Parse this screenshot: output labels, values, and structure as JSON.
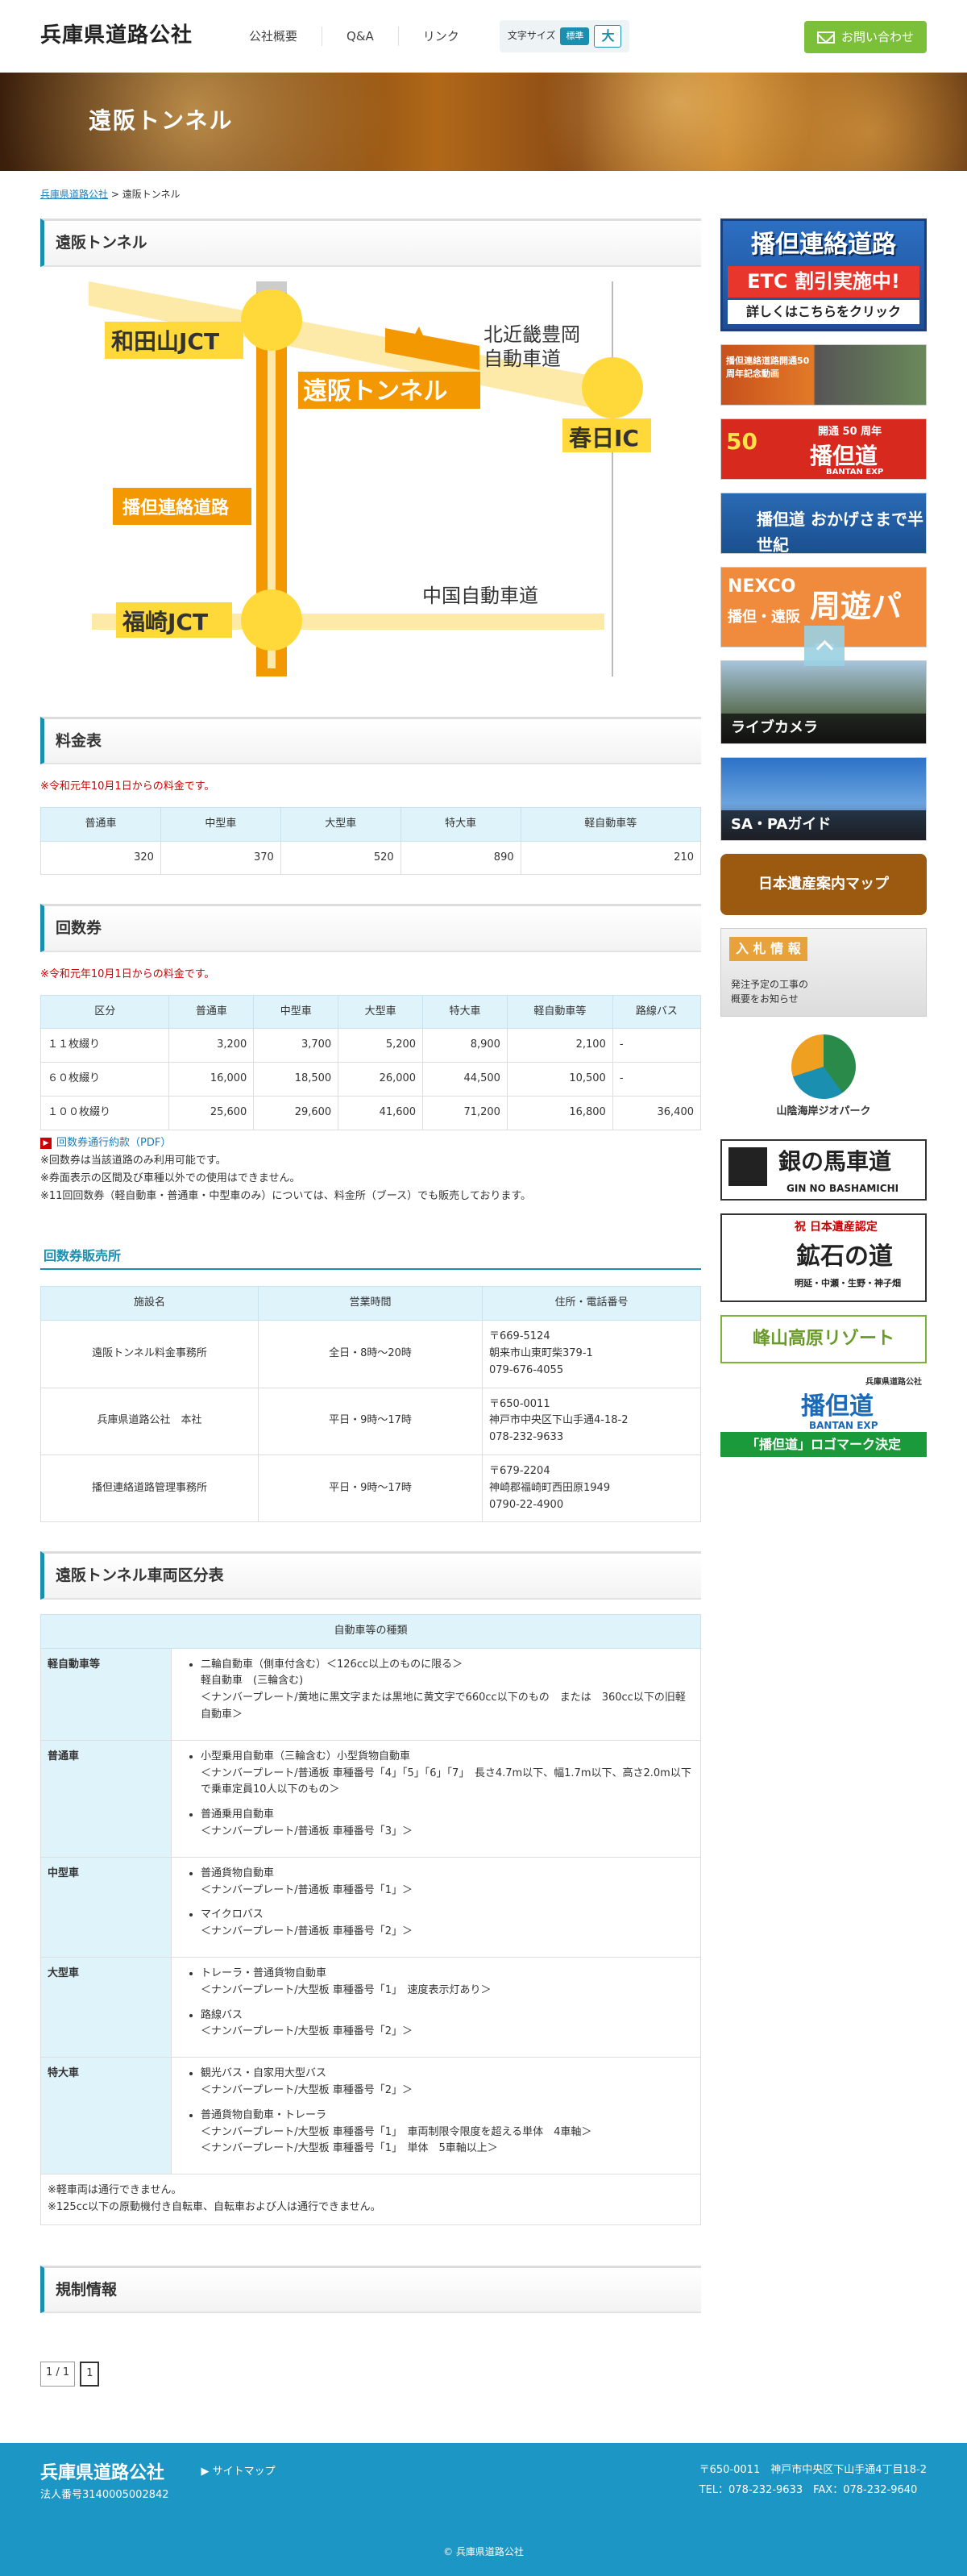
{
  "header": {
    "logo": "兵庫県道路公社",
    "nav": [
      "公社概要",
      "Q&A",
      "リンク"
    ],
    "fontsize_label": "文字サイズ",
    "fs_normal": "標準",
    "fs_big": "大",
    "contact": "お問い合わせ"
  },
  "banner": {
    "title": "遠阪トンネル"
  },
  "breadcrumb": {
    "home": "兵庫県道路公社",
    "sep": " > ",
    "current": "遠阪トンネル"
  },
  "section_title": "遠阪トンネル",
  "map": {
    "wadayama": "和田山JCT",
    "tunnel": "遠阪トンネル",
    "kitakinki1": "北近畿豊岡",
    "kitakinki2": "自動車道",
    "kasuga": "春日IC",
    "bantan": "播但連絡道路",
    "fukusaki": "福崎JCT",
    "chugoku": "中国自動車道"
  },
  "fare": {
    "title": "料金表",
    "note": "※令和元年10月1日からの料金です。",
    "headers": [
      "普通車",
      "中型車",
      "大型車",
      "特大車",
      "軽自動車等"
    ],
    "values": [
      "320",
      "370",
      "520",
      "890",
      "210"
    ]
  },
  "coupon": {
    "title": "回数券",
    "note": "※令和元年10月1日からの料金です。",
    "headers": [
      "区分",
      "普通車",
      "中型車",
      "大型車",
      "特大車",
      "軽自動車等",
      "路線バス"
    ],
    "rows": [
      [
        "１１枚綴り",
        "3,200",
        "3,700",
        "5,200",
        "8,900",
        "2,100",
        "-"
      ],
      [
        "６０枚綴り",
        "16,000",
        "18,500",
        "26,000",
        "44,500",
        "10,500",
        "-"
      ],
      [
        "１００枚綴り",
        "25,600",
        "29,600",
        "41,600",
        "71,200",
        "16,800",
        "36,400"
      ]
    ],
    "pdf": "回数券通行約款（PDF）",
    "n1": "※回数券は当該道路のみ利用可能です。",
    "n2": "※券面表示の区間及び車種以外での使用はできません。",
    "n3": "※11回回数券（軽自動車・普通車・中型車のみ）については、料金所（ブース）でも販売しております。"
  },
  "shops": {
    "title": "回数券販売所",
    "headers": [
      "施設名",
      "営業時間",
      "住所・電話番号"
    ],
    "rows": [
      {
        "name": "遠阪トンネル料金事務所",
        "hours": "全日・8時～20時",
        "a1": "〒669-5124",
        "a2": "朝来市山東町柴379-1",
        "a3": "079-676-4055"
      },
      {
        "name": "兵庫県道路公社　本社",
        "hours": "平日・9時～17時",
        "a1": "〒650-0011",
        "a2": "神戸市中央区下山手通4-18-2",
        "a3": "078-232-9633"
      },
      {
        "name": "播但連絡道路管理事務所",
        "hours": "平日・9時～17時",
        "a1": "〒679-2204",
        "a2": "神崎郡福崎町西田原1949",
        "a3": "0790-22-4900"
      }
    ]
  },
  "vehicle": {
    "title": "遠阪トンネル車両区分表",
    "header": "自動車等の種類",
    "rows": [
      {
        "label": "軽自動車等",
        "items": [
          [
            "二輪自動車（側車付含む）＜126cc以上のものに限る＞",
            "軽自動車　(三輪含む)",
            "＜ナンバープレート/黄地に黒文字または黒地に黄文字で660cc以下のもの　または　360cc以下の旧軽自動車＞"
          ]
        ]
      },
      {
        "label": "普通車",
        "items": [
          [
            "小型乗用自動車（三輪含む）小型貨物自動車",
            "＜ナンバープレート/普通板 車種番号「4」「5」「6」「7」　長さ4.7m以下、幅1.7m以下、高さ2.0m以下で乗車定員10人以下のもの＞"
          ],
          [
            "普通乗用自動車",
            "＜ナンバープレート/普通板 車種番号「3」＞"
          ]
        ]
      },
      {
        "label": "中型車",
        "items": [
          [
            "普通貨物自動車",
            "＜ナンバープレート/普通板 車種番号「1」＞"
          ],
          [
            "マイクロバス",
            "＜ナンバープレート/普通板 車種番号「2」＞"
          ]
        ]
      },
      {
        "label": "大型車",
        "items": [
          [
            "トレーラ・普通貨物自動車",
            "＜ナンバープレート/大型板 車種番号「1」　速度表示灯あり＞"
          ],
          [
            "路線バス",
            "＜ナンバープレート/大型板 車種番号「2」＞"
          ]
        ]
      },
      {
        "label": "特大車",
        "items": [
          [
            "観光バス・自家用大型バス",
            "＜ナンバープレート/大型板 車種番号「2」＞"
          ],
          [
            "普通貨物自動車・トレーラ",
            "＜ナンバープレート/大型板 車種番号「1」　車両制限令限度を超える単体　4車軸＞",
            "＜ナンバープレート/大型板 車種番号「1」　単体　5車軸以上＞"
          ]
        ]
      }
    ],
    "f1": "※軽車両は通行できません。",
    "f2": "※125cc以下の原動機付き自転車、自転車および人は通行できません。"
  },
  "regulation": {
    "title": "規制情報"
  },
  "pager": {
    "info": "1 / 1",
    "page": "1"
  },
  "side": {
    "b1a": "播但連絡道路",
    "b1b": "ETC 割引実施中!",
    "b1c": "詳しくはこちらをクリック",
    "b2": "播但連絡道路開通50周年記念動画",
    "b3a": "開通 50 周年",
    "b3b": "播但道",
    "b3c": "BANTAN EXP",
    "b4": "播但道 おかげさまで半世紀",
    "b5a": "NEXCO",
    "b5b": "播但・遠阪",
    "b5c": "周遊パス",
    "b6": "ライブカメラ",
    "b7": "SA・PAガイド",
    "b8": "日本遺産案内マップ",
    "b9a": "入 札 情 報",
    "b9b": "発注予定の工事の",
    "b9c": "概要をお知らせ",
    "b10": "山陰海岸ジオパーク",
    "b11a": "銀の馬車道",
    "b11b": "GIN NO BASHAMICHI",
    "b12a": "祝 日本遺産認定",
    "b12b": "鉱石の道",
    "b12c": "明延・中瀬・生野・神子畑",
    "b13": "峰山高原リゾート",
    "b14a": "兵庫県道路公社",
    "b14b": "播但道",
    "b14c": "BANTAN EXP",
    "b14d": "「播但道」ロゴマーク決定"
  },
  "footer": {
    "logo": "兵庫県道路公社",
    "corp": "法人番号3140005002842",
    "sitemap": "サイトマップ",
    "addr": "〒650-0011　神戸市中央区下山手通4丁目18-2",
    "tel": "TEL：078-232-9633　FAX：078-232-9640",
    "copy": "© 兵庫県道路公社"
  },
  "colors": {
    "accent": "#1a8fb0",
    "road": "#f39800",
    "ic": "#ffd93a",
    "light_road": "#fde9a8"
  }
}
